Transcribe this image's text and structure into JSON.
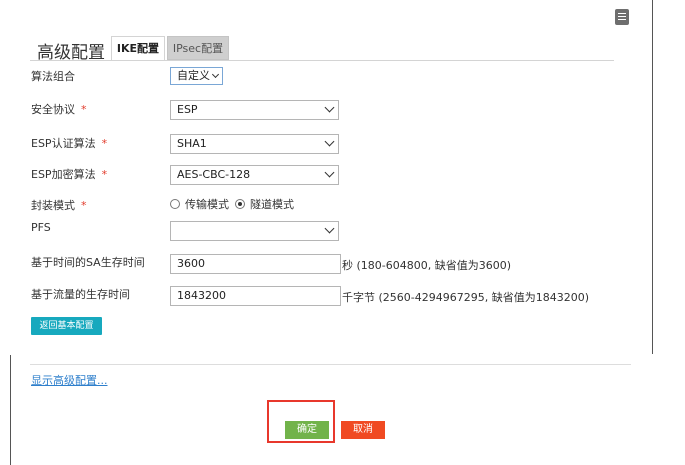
{
  "header": {
    "title": "高级配置",
    "tabs": [
      {
        "label": "IKE配置",
        "active": true
      },
      {
        "label": "IPsec配置",
        "active": false
      }
    ],
    "note_icon": "notepad-icon"
  },
  "form": {
    "algorithm_suite": {
      "label": "算法组合",
      "value": "自定义"
    },
    "security_protocol": {
      "label": "安全协议",
      "required": "*",
      "value": "ESP"
    },
    "esp_auth": {
      "label": "ESP认证算法",
      "required": "*",
      "value": "SHA1"
    },
    "esp_encryption": {
      "label": "ESP加密算法",
      "required": "*",
      "value": "AES-CBC-128"
    },
    "encapsulation": {
      "label": "封装模式",
      "required": "*",
      "options": [
        {
          "label": "传输模式",
          "selected": false
        },
        {
          "label": "隧道模式",
          "selected": true
        }
      ]
    },
    "pfs": {
      "label": "PFS",
      "value": ""
    },
    "sa_time_lifetime": {
      "label": "基于时间的SA生存时间",
      "value": "3600",
      "hint": "秒 (180-604800, 缺省值为3600)"
    },
    "sa_traffic_lifetime": {
      "label": "基于流量的生存时间",
      "value": "1843200",
      "hint": "千字节 (2560-4294967295, 缺省值为1843200)"
    }
  },
  "buttons": {
    "back_basic": "返回基本配置",
    "show_advanced": "显示高级配置...",
    "ok": "确定",
    "cancel": "取消"
  },
  "colors": {
    "accent_teal": "#17a9be",
    "ok_green": "#72b34a",
    "cancel_red": "#f04a22",
    "highlight_red": "#e8382c",
    "required_red": "#e23b2b",
    "link_blue": "#2e7fcc"
  }
}
